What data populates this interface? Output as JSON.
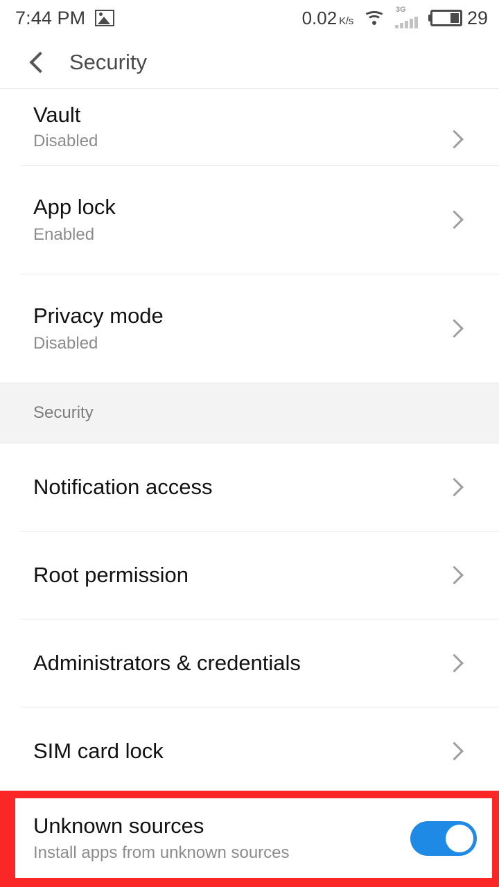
{
  "status_bar": {
    "clock": "7:44 PM",
    "photo_icon": "photo-icon",
    "network_speed_value": "0.02",
    "network_speed_unit": "K/s",
    "wifi_icon": "wifi-icon",
    "signal_generation": "3G",
    "signal_icon": "signal-bars-icon",
    "battery_icon": "battery-icon",
    "battery_percent": "29"
  },
  "app_bar": {
    "back_icon": "back-chevron-icon",
    "title": "Security"
  },
  "colors": {
    "toggle_on": "#1e8ae5",
    "highlight": "#fb2727",
    "section_band": "#f3f3f3",
    "title_text": "#111111",
    "sub_text": "#8c8c8c"
  },
  "list": {
    "items": [
      {
        "title": "Vault",
        "subtitle": "Disabled",
        "accessory": "chevron",
        "clipped": true
      },
      {
        "title": "App lock",
        "subtitle": "Enabled",
        "accessory": "chevron"
      },
      {
        "title": "Privacy mode",
        "subtitle": "Disabled",
        "accessory": "chevron"
      }
    ]
  },
  "section": {
    "label": "Security",
    "items": [
      {
        "title": "Notification access",
        "accessory": "chevron"
      },
      {
        "title": "Root permission",
        "accessory": "chevron"
      },
      {
        "title": "Administrators & credentials",
        "accessory": "chevron"
      },
      {
        "title": "SIM card lock",
        "accessory": "chevron"
      }
    ]
  },
  "highlighted_row": {
    "title": "Unknown sources",
    "subtitle": "Install apps from unknown sources",
    "toggle_state": "on"
  }
}
